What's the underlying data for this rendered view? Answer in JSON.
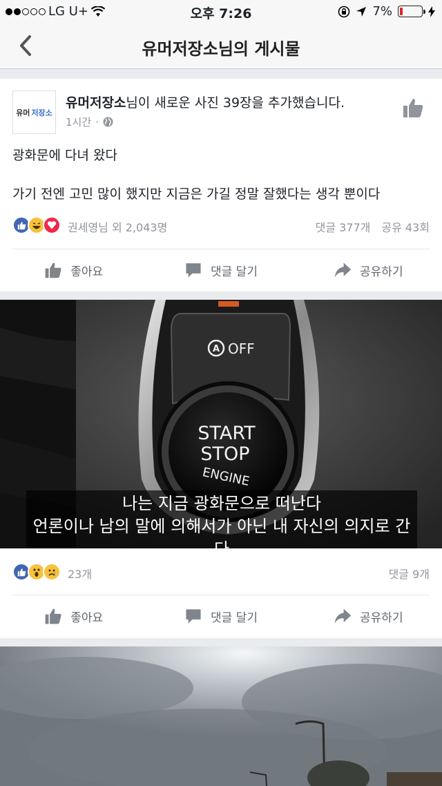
{
  "status_bar": {
    "carrier": "LG U+",
    "time": "오후 7:26",
    "battery": "7%"
  },
  "nav": {
    "title": "유머저장소님의 게시물"
  },
  "post": {
    "author": "유머저장소",
    "action_text": "님이 새로운 사진 39장을 추가했습니다.",
    "avatar_text_a": "유머",
    "avatar_text_b": "저장소",
    "time": "1시간",
    "separator": "·",
    "body_line1": "광화문에 다녀 왔다",
    "body_line2": "가기 전엔 고민 많이 했지만 지금은 가길 정말 잘했다는 생각 뿐이다",
    "reactions_names": "권세영님 외 2,043명",
    "comments": "댓글 377개",
    "shares": "공유 43회",
    "actions": {
      "like": "좋아요",
      "comment": "댓글 달기",
      "share": "공유하기"
    }
  },
  "photo": {
    "button_off": "OFF",
    "button_start": "START",
    "button_stop": "STOP",
    "button_engine": "ENGINE",
    "caption_line1": "나는 지금 광화문으로 떠난다",
    "caption_line2": "언론이나 남의 말에 의해서가 아닌 내 자신의 의지로 간다"
  },
  "photo_post": {
    "reactions_count": "23개",
    "comments": "댓글 9개",
    "actions": {
      "like": "좋아요",
      "comment": "댓글 달기",
      "share": "공유하기"
    }
  },
  "colors": {
    "facebook_blue": "#4267b2",
    "text_gray": "#90949c",
    "action_gray": "#606770",
    "battery_red": "#e02424"
  }
}
